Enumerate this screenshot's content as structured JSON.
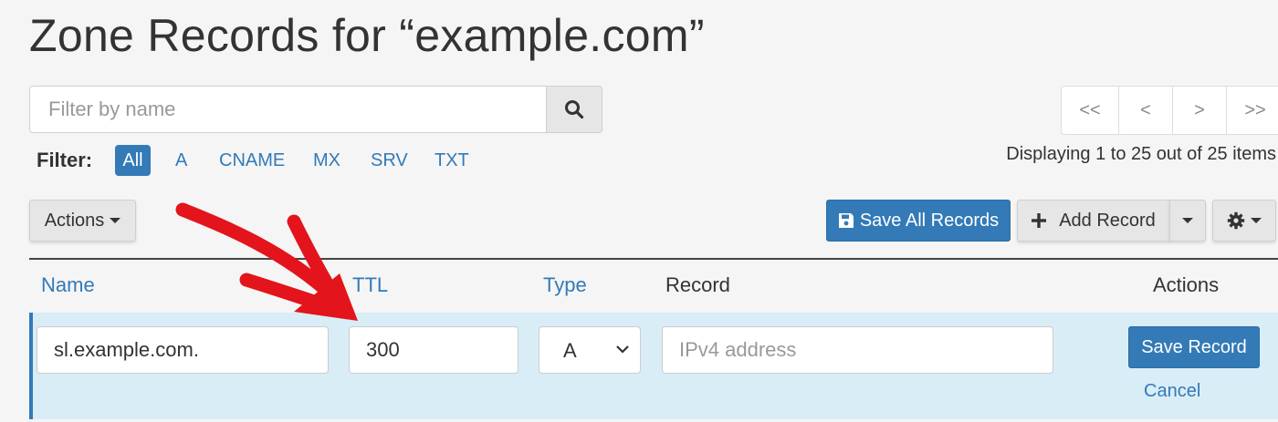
{
  "page": {
    "title": "Zone Records for “example.com”"
  },
  "search": {
    "placeholder": "Filter by name",
    "button_icon": "search-icon"
  },
  "filter": {
    "label": "Filter:",
    "options": [
      "All",
      "A",
      "CNAME",
      "MX",
      "SRV",
      "TXT"
    ],
    "active": "All"
  },
  "pagination": {
    "first": "<<",
    "prev": "<",
    "next": ">",
    "last": ">>",
    "summary": "Displaying 1 to 25 out of 25 items"
  },
  "toolbar": {
    "actions_label": "Actions",
    "save_all_label": "Save All Records",
    "add_record_label": "Add Record",
    "settings_icon": "gear-icon"
  },
  "table": {
    "headers": {
      "name": "Name",
      "ttl": "TTL",
      "type": "Type",
      "record": "Record",
      "actions": "Actions"
    }
  },
  "edit_row": {
    "name_value": "sl.example.com.",
    "ttl_value": "300",
    "type_value": "A",
    "record_placeholder": "IPv4 address",
    "save_label": "Save Record",
    "cancel_label": "Cancel"
  },
  "colors": {
    "primary": "#337ab7",
    "row_highlight": "#d9edf7",
    "annotation_arrow": "#e3141b"
  }
}
